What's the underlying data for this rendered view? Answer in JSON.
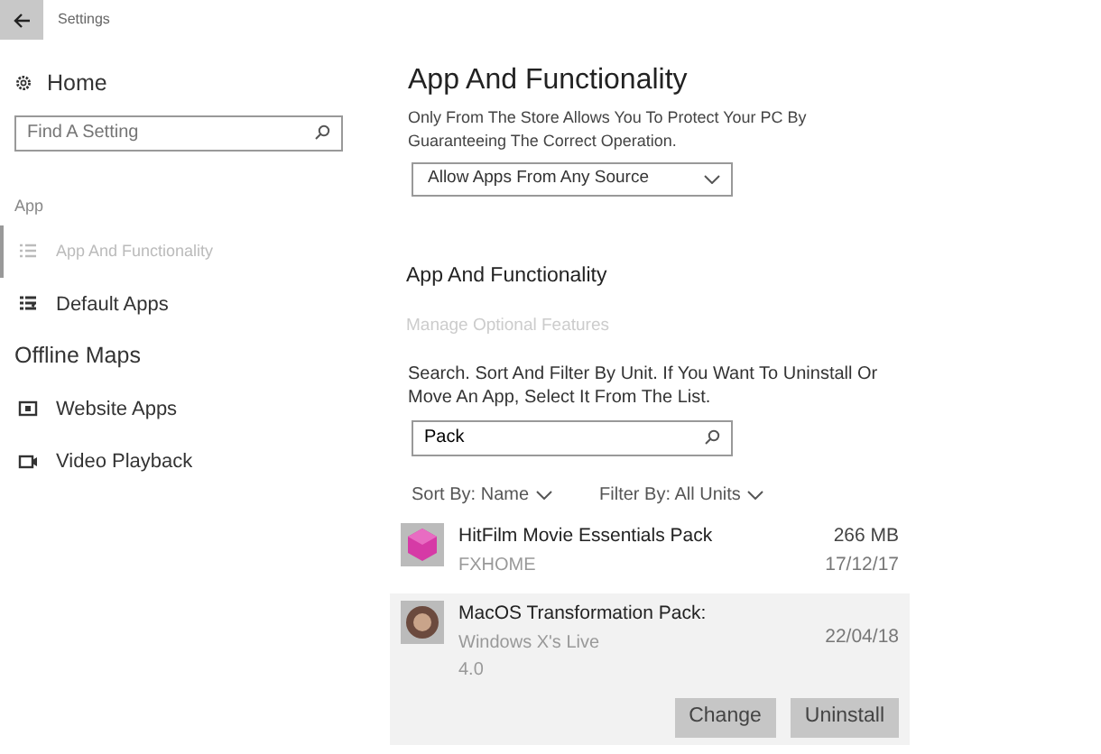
{
  "window": {
    "title": "Settings"
  },
  "sidebar": {
    "home": "Home",
    "search": {
      "placeholder": "Find A Setting"
    },
    "section": "App",
    "items": [
      {
        "label": "App And Functionality",
        "kind": "link",
        "selected": true
      },
      {
        "label": "Default Apps",
        "kind": "link",
        "selected": false
      },
      {
        "label": "Offline Maps",
        "kind": "plain",
        "selected": false
      },
      {
        "label": "Website Apps",
        "kind": "link",
        "selected": false
      },
      {
        "label": "Video Playback",
        "kind": "link",
        "selected": false
      }
    ]
  },
  "main": {
    "heading": "App And Functionality",
    "description": "Only From The Store Allows You To Protect Your PC By Guaranteeing The Correct Operation.",
    "dropdown": "Allow Apps From Any Source",
    "heading_2": "App And Functionality",
    "link": "Manage Optional Features",
    "instructions": "Search. Sort And Filter By Unit. If You Want To Uninstall Or Move An App, Select It From The List.",
    "search": {
      "value": "Pack"
    },
    "sort": "Sort By: Name",
    "filter": "Filter By: All Units",
    "apps": [
      {
        "name": "HitFilm Movie Essentials Pack",
        "publisher": "FXHOME",
        "size": "266 MB",
        "date": "17/12/17",
        "selected": false
      },
      {
        "name": "MacOS Transformation Pack:",
        "publisher": "Windows X's Live",
        "version": "4.0",
        "date": "22/04/18",
        "selected": true,
        "buttons": [
          "Change",
          "Uninstall"
        ]
      }
    ]
  }
}
